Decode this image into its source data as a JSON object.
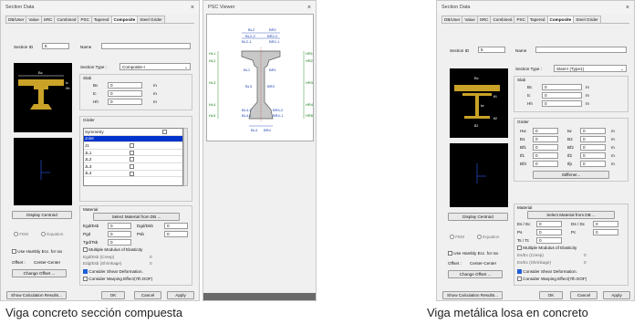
{
  "left_dialog": {
    "title": "Section Data",
    "tabs": [
      "DB/User",
      "Value",
      "SRC",
      "Combined",
      "PSC",
      "Tapered",
      "Composite",
      "Steel Girder"
    ],
    "section_id_label": "Section ID",
    "section_id_value": "5",
    "name_label": "Name",
    "section_type_label": "Section Type :",
    "section_type_value": "Composite-I",
    "slab_label": "Slab",
    "slab_fields": [
      {
        "label": "Bc",
        "value": "0",
        "unit": "m"
      },
      {
        "label": "tc",
        "value": "0",
        "unit": "m"
      },
      {
        "label": "Hh",
        "value": "0",
        "unit": "m"
      }
    ],
    "girder_label": "Girder",
    "girder_rows": [
      "Symmetry",
      "Joint",
      "J1",
      "JL1",
      "JL2",
      "JL3",
      "JL4"
    ],
    "display_centroid": "Display Centroid",
    "fem_label": "FEM",
    "equation_label": "Equation",
    "material_label": "Material",
    "select_material": "Select Material from DB ...",
    "egd_esb": "Egd/Esb",
    "egd_esb_val": "0",
    "dgd_dsb": "Dgd/Dsb",
    "dgd_dsb_val": "0",
    "pgd": "Pgd",
    "pgd_val": "0",
    "psb": "Psb",
    "psb_val": "0",
    "tgd_tsb": "Tgd/Tsb",
    "tgd_tsb_val": "0",
    "multiple_modulus": "Multiple Modulus of Elasticity",
    "egd_creep": "Egd/Esb (Creep)",
    "egd_creep_val": "0",
    "edg_shrinkage": "Edg/Esb (Shrinkage)",
    "edg_shrinkage_val": "0",
    "use_hambly": "Use Hambly Ecc. for Ixx",
    "offset_label": "Offset :",
    "offset_value": "Center-Center",
    "change_offset": "Change Offset ...",
    "consider_shear": "Consider Shear Deformation.",
    "consider_warping": "Consider Warping Effect(7th DOF)",
    "show_calc": "Show Calculation Results...",
    "ok": "OK",
    "cancel": "Cancel",
    "apply": "Apply"
  },
  "psc_viewer": {
    "title": "PSC Viewer",
    "labels_top": [
      "BL2",
      "BR2",
      "BL2-2",
      "BR2-2",
      "BL2-1",
      "BR2-1",
      "BL1",
      "BR1",
      "BL3",
      "BR3",
      "BL4",
      "BR4",
      "BL4-2",
      "BR4-2",
      "BL4-1",
      "BR4-1"
    ],
    "labels_side_left": [
      "HL1",
      "HL2",
      "HL3",
      "HL4",
      "HL5"
    ],
    "labels_side_right": [
      "HR1",
      "HR2",
      "HR3",
      "HR4",
      "HR5"
    ]
  },
  "right_dialog": {
    "title": "Section Data",
    "tabs": [
      "DB/User",
      "Value",
      "SRC",
      "Combined",
      "PSC",
      "Tapered",
      "Composite",
      "Steel Girder"
    ],
    "section_id_label": "Section ID",
    "section_id_value": "5",
    "name_label": "Name",
    "section_type_label": "Section Type :",
    "section_type_value": "Steel-I (Type1)",
    "slab_label": "Slab",
    "slab_fields": [
      {
        "label": "Bc",
        "value": "0",
        "unit": "m"
      },
      {
        "label": "tc",
        "value": "0",
        "unit": "m"
      },
      {
        "label": "Hh",
        "value": "0",
        "unit": "m"
      }
    ],
    "girder_label": "Girder",
    "girder_fields_left": [
      {
        "label": "Hw",
        "value": "0"
      },
      {
        "label": "B1",
        "value": "0"
      },
      {
        "label": "Bf1",
        "value": "0"
      },
      {
        "label": "tf1",
        "value": "0"
      },
      {
        "label": "Bf3",
        "value": "0"
      }
    ],
    "girder_fields_right": [
      {
        "label": "tw",
        "value": "0",
        "unit": "m"
      },
      {
        "label": "B2",
        "value": "0",
        "unit": "m"
      },
      {
        "label": "Bf2",
        "value": "0",
        "unit": "m"
      },
      {
        "label": "tf2",
        "value": "0",
        "unit": "m"
      },
      {
        "label": "tfp",
        "value": "0",
        "unit": "m"
      }
    ],
    "stiffener": "Stiffener...",
    "display_centroid": "Display Centroid",
    "fem_label": "FEM",
    "equation_label": "Equation",
    "material_label": "Material",
    "select_material": "Select Material from DB ...",
    "es_ec": "Es / Ec",
    "es_ec_val": "0",
    "ds_dc": "Ds / Dc",
    "ds_dc_val": "0",
    "ps": "Ps",
    "ps_val": "0",
    "pc": "Pc",
    "pc_val": "0",
    "ts_tc": "Ts / Tc",
    "ts_tc_val": "0",
    "multiple_modulus": "Multiple Modulus of Elasticity",
    "es_creep": "Es/Ec (Creep)",
    "es_creep_val": "0",
    "es_shrinkage": "Es/Ec (Shrinkage)",
    "es_shrinkage_val": "0",
    "use_hambly": "Use Hambly Ecc. for Ixx",
    "offset_label": "Offset :",
    "offset_value": "Center-Center",
    "change_offset": "Change Offset ...",
    "consider_shear": "Consider Shear Deformation.",
    "consider_warping": "Consider Warping Effect(7th DOF)",
    "show_calc": "Show Calculation Results...",
    "ok": "OK",
    "cancel": "Cancel",
    "apply": "Apply"
  },
  "captions": {
    "left": "Viga concreto sección compuesta",
    "right": "Viga metálica losa en concreto"
  },
  "colors": {
    "accent": "#0033cc",
    "section_fill": "#c8c8c8",
    "dim_blue": "#1a3fb0",
    "dim_red": "#cc0000",
    "dim_green": "#0a7a0a",
    "beam_gold": "#c9a227"
  }
}
